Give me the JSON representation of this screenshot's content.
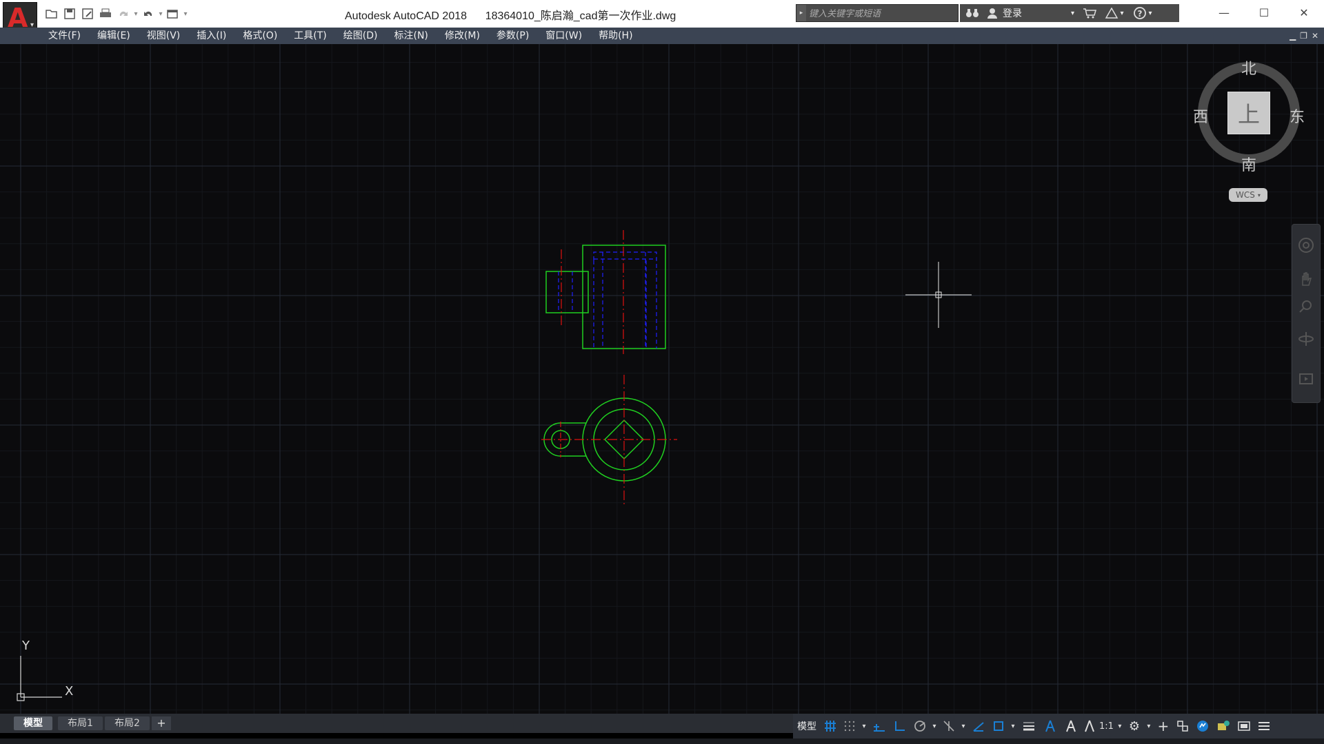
{
  "app": {
    "title": "Autodesk AutoCAD 2018",
    "document": "18364010_陈启瀚_cad第一次作业.dwg",
    "logo_letter": "A"
  },
  "search": {
    "placeholder": "键入关键字或短语"
  },
  "account": {
    "login_label": "登录"
  },
  "menu": [
    "文件(F)",
    "编辑(E)",
    "视图(V)",
    "插入(I)",
    "格式(O)",
    "工具(T)",
    "绘图(D)",
    "标注(N)",
    "修改(M)",
    "参数(P)",
    "窗口(W)",
    "帮助(H)"
  ],
  "viewcube": {
    "north": "北",
    "south": "南",
    "east": "东",
    "west": "西",
    "face": "上",
    "wcs": "WCS"
  },
  "ucs": {
    "x": "X",
    "y": "Y"
  },
  "tabs": {
    "model": "模型",
    "layout1": "布局1",
    "layout2": "布局2",
    "add": "+"
  },
  "status": {
    "model": "模型",
    "scale": "1:1"
  },
  "colors": {
    "geometry": "#20d020",
    "centerline": "#e01010",
    "hidden": "#2020ff",
    "grid_major": "#262b36",
    "grid_minor": "#15171c",
    "accent": "#1a7fd4"
  }
}
